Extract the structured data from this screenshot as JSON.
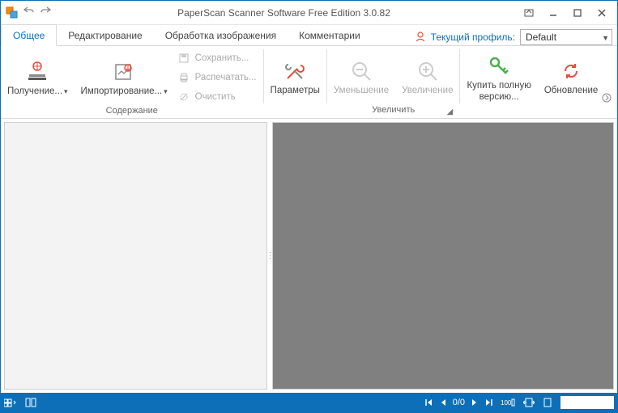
{
  "title": "PaperScan Scanner Software Free Edition 3.0.82",
  "tabs": {
    "general": "Общее",
    "editing": "Редактирование",
    "image_processing": "Обработка изображения",
    "comments": "Комментарии"
  },
  "profile": {
    "label": "Текущий профиль:",
    "value": "Default"
  },
  "ribbon": {
    "acquire": {
      "label": "Получение..."
    },
    "import": {
      "label": "Импортирование..."
    },
    "save": {
      "label": "Сохранить..."
    },
    "print": {
      "label": "Распечатать..."
    },
    "clear": {
      "label": "Очистить"
    },
    "group_content": "Содержание",
    "options": {
      "label": "Параметры"
    },
    "zoom_out": {
      "label": "Уменьшение"
    },
    "zoom_in": {
      "label": "Увеличение"
    },
    "group_zoom": "Увеличить",
    "buy_full": {
      "line1": "Купить полную",
      "line2": "версию..."
    },
    "update": {
      "label": "Обновление"
    }
  },
  "status": {
    "page_counter": "0/0"
  }
}
